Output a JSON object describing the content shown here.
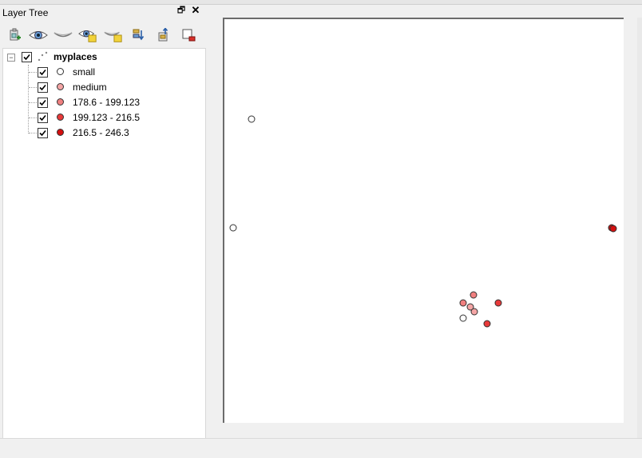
{
  "panel": {
    "title": "Layer Tree",
    "float_glyph": "🗗",
    "close_glyph": "✕"
  },
  "toolbar": {
    "buttons": [
      {
        "name": "add-group-icon"
      },
      {
        "name": "show-all-layers-icon"
      },
      {
        "name": "hide-all-layers-icon"
      },
      {
        "name": "show-selected-layers-icon"
      },
      {
        "name": "hide-selected-layers-icon"
      },
      {
        "name": "filter-legend-icon"
      },
      {
        "name": "expand-all-icon"
      },
      {
        "name": "remove-layer-icon"
      }
    ]
  },
  "layer": {
    "name": "myplaces",
    "checked": true,
    "expander": "−",
    "classes": [
      {
        "label": "small",
        "color": "#ffffff",
        "checked": true
      },
      {
        "label": "medium",
        "color": "#f4a5a5",
        "checked": true
      },
      {
        "label": "178.6 - 199.123",
        "color": "#f08080",
        "checked": true
      },
      {
        "label": "199.123 - 216.5",
        "color": "#e83a3a",
        "checked": true
      },
      {
        "label": "216.5 - 246.3",
        "color": "#d40f0f",
        "checked": true
      }
    ]
  },
  "map": {
    "background": "#ffffff",
    "point_stroke": "#333333"
  }
}
